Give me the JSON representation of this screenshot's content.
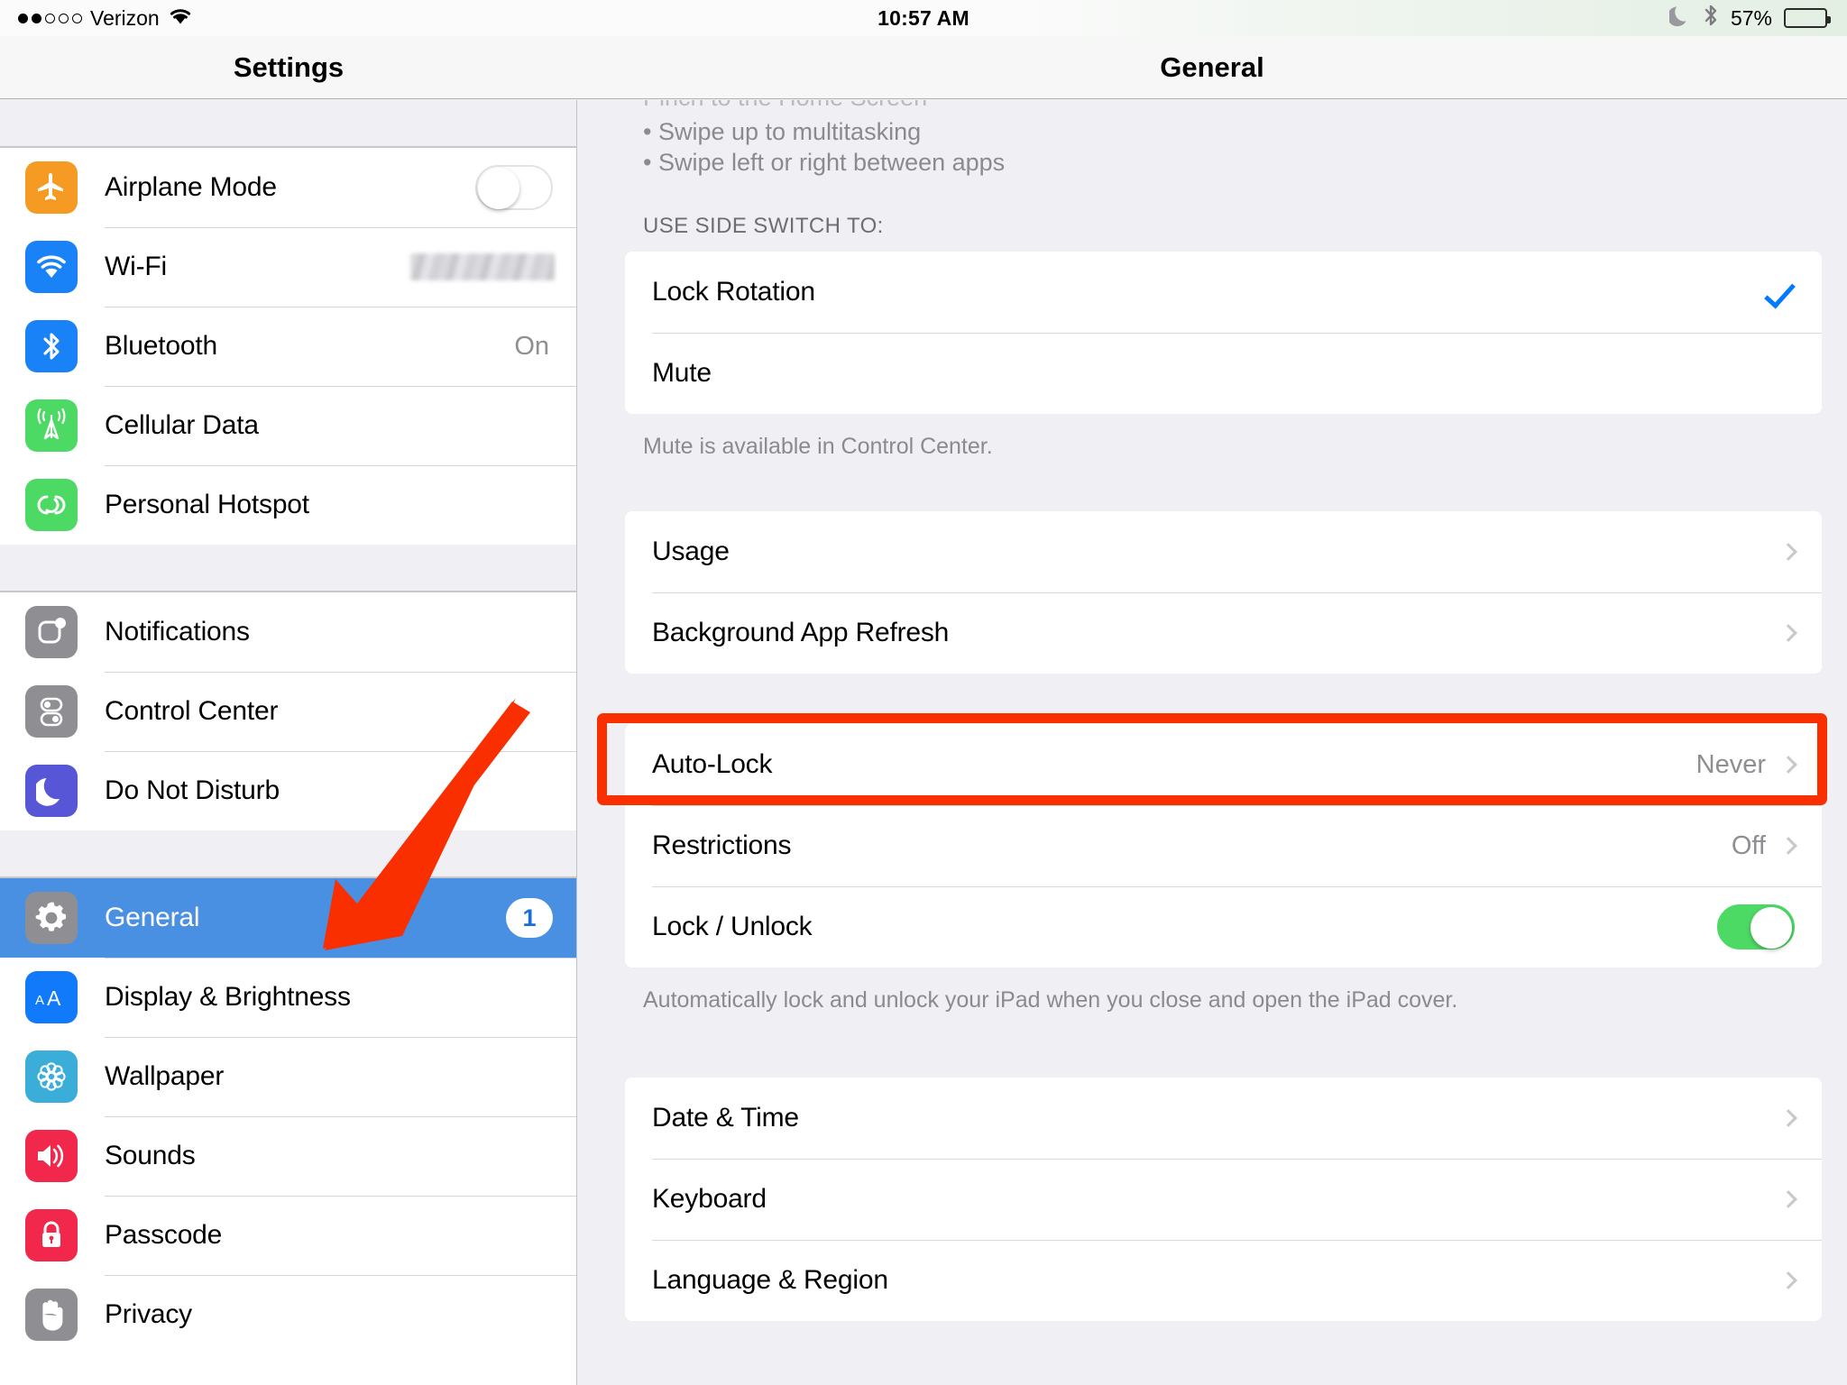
{
  "status_bar": {
    "signal_dots_total": 5,
    "signal_dots_filled": 2,
    "carrier": "Verizon",
    "wifi_icon": "wifi-icon",
    "time": "10:57 AM",
    "dnd_icon": "moon-icon",
    "bluetooth_icon": "bluetooth-icon",
    "battery_percent": "57%",
    "battery_level": 57
  },
  "sidebar": {
    "title": "Settings",
    "groups": [
      {
        "items": [
          {
            "label": "Airplane Mode",
            "icon": "airplane-icon",
            "icon_color": "#f59a23",
            "accessory": "toggle",
            "toggle_on": false
          },
          {
            "label": "Wi-Fi",
            "icon": "wifi-icon",
            "icon_color": "#1a82f7",
            "accessory": "redacted"
          },
          {
            "label": "Bluetooth",
            "icon": "bluetooth-icon",
            "icon_color": "#1a82f7",
            "accessory": "value",
            "value": "On"
          },
          {
            "label": "Cellular Data",
            "icon": "cellular-antenna-icon",
            "icon_color": "#4cd964",
            "accessory": "none"
          },
          {
            "label": "Personal Hotspot",
            "icon": "hotspot-link-icon",
            "icon_color": "#4cd964",
            "accessory": "none"
          }
        ]
      },
      {
        "items": [
          {
            "label": "Notifications",
            "icon": "notifications-icon",
            "icon_color": "#8e8e93",
            "accessory": "none"
          },
          {
            "label": "Control Center",
            "icon": "control-center-icon",
            "icon_color": "#8e8e93",
            "accessory": "none"
          },
          {
            "label": "Do Not Disturb",
            "icon": "moon-icon",
            "icon_color": "#5756d6",
            "accessory": "none"
          }
        ]
      },
      {
        "items": [
          {
            "label": "General",
            "icon": "gear-icon",
            "icon_color": "#8e8e93",
            "accessory": "badge",
            "badge": "1",
            "selected": true
          },
          {
            "label": "Display & Brightness",
            "icon": "display-brightness-icon",
            "icon_color": "#107afb",
            "accessory": "none"
          },
          {
            "label": "Wallpaper",
            "icon": "wallpaper-flower-icon",
            "icon_color": "#3aadd9",
            "accessory": "none"
          },
          {
            "label": "Sounds",
            "icon": "speaker-icon",
            "icon_color": "#f2274c",
            "accessory": "none"
          },
          {
            "label": "Passcode",
            "icon": "lock-icon",
            "icon_color": "#f2274c",
            "accessory": "none"
          },
          {
            "label": "Privacy",
            "icon": "hand-icon",
            "icon_color": "#8e8e93",
            "accessory": "none"
          }
        ]
      }
    ]
  },
  "detail": {
    "title": "General",
    "scrolled_fragment": {
      "clipped_line": "Pinch to the Home Screen",
      "lines": [
        "• Swipe up to multitasking",
        "• Swipe left or right between apps"
      ]
    },
    "sections": [
      {
        "header": "USE SIDE SWITCH TO:",
        "rows": [
          {
            "label": "Lock Rotation",
            "accessory": "check",
            "checked": true
          },
          {
            "label": "Mute",
            "accessory": "none"
          }
        ],
        "footnote": "Mute is available in Control Center."
      },
      {
        "header": "",
        "rows": [
          {
            "label": "Usage",
            "accessory": "chevron"
          },
          {
            "label": "Background App Refresh",
            "accessory": "chevron"
          }
        ],
        "footnote": ""
      },
      {
        "header": "",
        "highlighted": true,
        "rows": [
          {
            "label": "Auto-Lock",
            "accessory": "value-chevron",
            "value": "Never",
            "highlighted": true
          },
          {
            "label": "Restrictions",
            "accessory": "value-chevron",
            "value": "Off"
          },
          {
            "label": "Lock / Unlock",
            "accessory": "toggle",
            "toggle_on": true
          }
        ],
        "footnote": "Automatically lock and unlock your iPad when you close and open the iPad cover."
      },
      {
        "header": "",
        "rows": [
          {
            "label": "Date & Time",
            "accessory": "chevron"
          },
          {
            "label": "Keyboard",
            "accessory": "chevron"
          },
          {
            "label": "Language & Region",
            "accessory": "chevron"
          }
        ],
        "footnote": ""
      }
    ]
  },
  "annotations": {
    "highlight_color": "#fa2f00",
    "arrow_color": "#fa2f00",
    "highlight_target": "Auto-Lock",
    "arrow_target": "General"
  }
}
